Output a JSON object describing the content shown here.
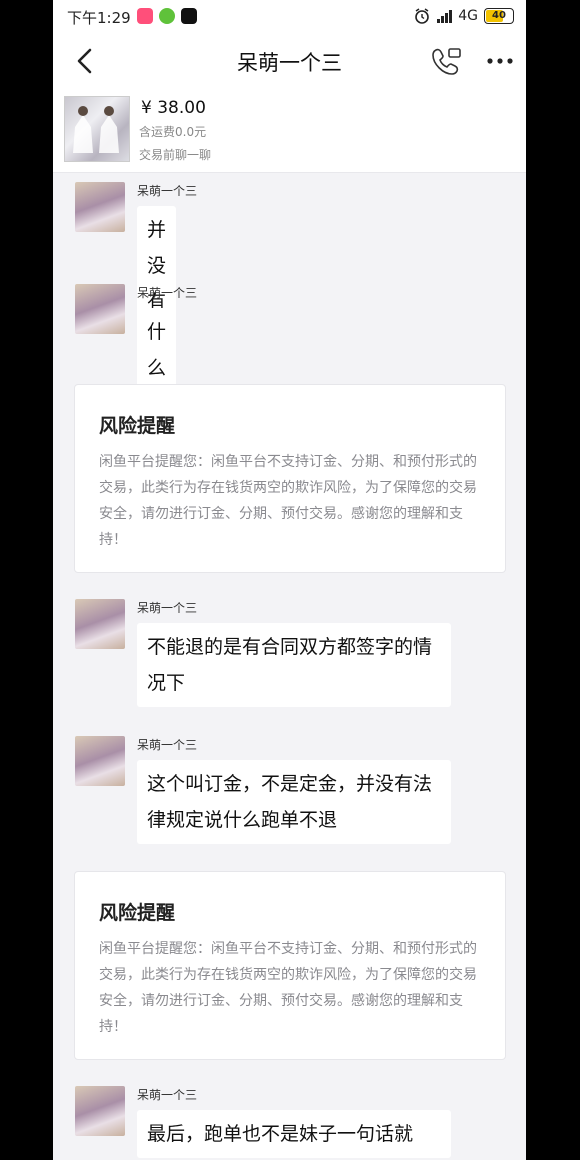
{
  "status_bar": {
    "time": "下午1:29",
    "network": "4G",
    "battery": "40"
  },
  "header": {
    "title": "呆萌一个三"
  },
  "product": {
    "price": "¥ 38.00",
    "shipping": "含运费0.0元",
    "chat_hint": "交易前聊一聊"
  },
  "messages": [
    {
      "sender": "呆萌一个三",
      "text": "并没有这件事"
    },
    {
      "sender": "呆萌一个三",
      "text": "什么定金不退"
    },
    {
      "sender": "呆萌一个三",
      "text": "不能退的是有合同双方都签字的情况下"
    },
    {
      "sender": "呆萌一个三",
      "text": "这个叫订金，不是定金，并没有法律规定说什么跑单不退"
    },
    {
      "sender": "呆萌一个三",
      "text": "最后，跑单也不是妹子一句话就"
    }
  ],
  "risk_notices": [
    {
      "title": "风险提醒",
      "text": "闲鱼平台提醒您：闲鱼平台不支持订金、分期、和预付形式的交易，此类行为存在钱货两空的欺诈风险，为了保障您的交易安全，请勿进行订金、分期、预付交易。感谢您的理解和支持！"
    },
    {
      "title": "风险提醒",
      "text": "闲鱼平台提醒您：闲鱼平台不支持订金、分期、和预付形式的交易，此类行为存在钱货两空的欺诈风险，为了保障您的交易安全，请勿进行订金、分期、预付交易。感谢您的理解和支持！"
    }
  ],
  "colors": {
    "background": "#f3f3f6",
    "bubble": "#ffffff",
    "accent_battery": "#f2c200"
  },
  "icons": [
    "back-arrow-icon",
    "voice-call-icon",
    "more-icon",
    "alarm-icon",
    "signal-icon",
    "battery-icon"
  ]
}
